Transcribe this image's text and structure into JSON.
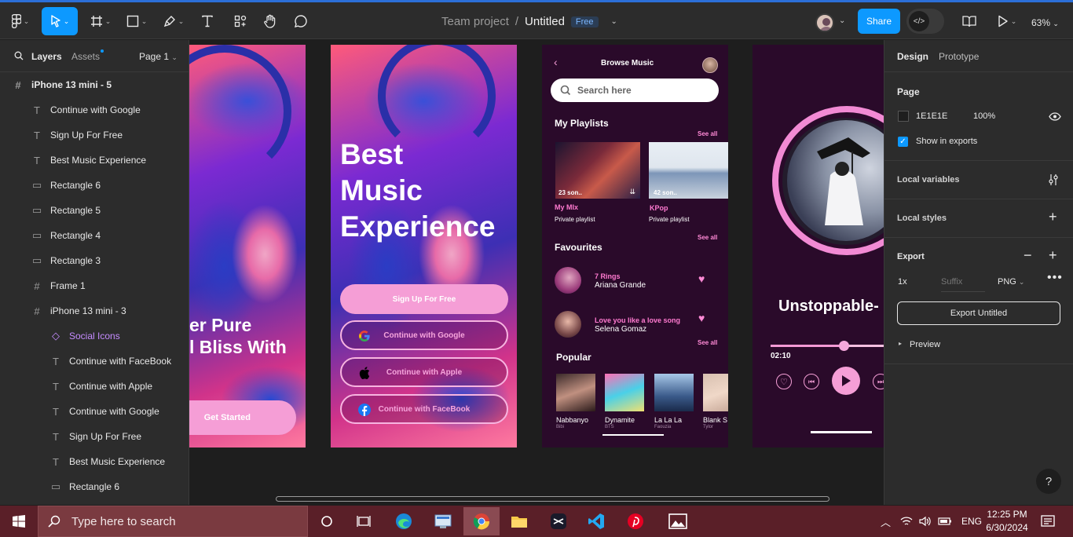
{
  "toolbar": {
    "project": "Team project",
    "separator": "/",
    "file": "Untitled",
    "plan_badge": "Free",
    "share": "Share",
    "zoom": "63%"
  },
  "left_panel": {
    "tabs": {
      "layers": "Layers",
      "assets": "Assets",
      "page": "Page 1"
    },
    "layers": [
      {
        "label": "iPhone 13 mini - 5",
        "icon": "frame-icon"
      },
      {
        "label": "Continue with Google",
        "icon": "text-icon"
      },
      {
        "label": "Sign Up For Free",
        "icon": "text-icon"
      },
      {
        "label": "Best Music Experience",
        "icon": "text-icon"
      },
      {
        "label": "Rectangle 6",
        "icon": "rectangle-icon"
      },
      {
        "label": "Rectangle 5",
        "icon": "rectangle-icon"
      },
      {
        "label": "Rectangle 4",
        "icon": "rectangle-icon"
      },
      {
        "label": "Rectangle 3",
        "icon": "rectangle-icon"
      },
      {
        "label": "Frame 1",
        "icon": "frame-icon"
      },
      {
        "label": "iPhone 13 mini - 3",
        "icon": "frame-icon"
      },
      {
        "label": "Social Icons",
        "icon": "component-icon"
      },
      {
        "label": "Continue with FaceBook",
        "icon": "text-icon"
      },
      {
        "label": "Continue with Apple",
        "icon": "text-icon"
      },
      {
        "label": "Continue with Google",
        "icon": "text-icon"
      },
      {
        "label": "Sign Up For Free",
        "icon": "text-icon"
      },
      {
        "label": "Best Music Experience",
        "icon": "text-icon"
      },
      {
        "label": "Rectangle 6",
        "icon": "rectangle-icon"
      }
    ]
  },
  "canvas": {
    "frame1": {
      "line1": "er Pure",
      "line2": "l Bliss With",
      "cta": "Get Started"
    },
    "frame2": {
      "title_1": "Best",
      "title_2": "Music",
      "title_3": "Experience",
      "signup": "Sign Up For Free",
      "google": "Continue with Google",
      "apple": "Continue with Apple",
      "facebook": "Continue with FaceBook"
    },
    "browse": {
      "header": "Browse Music",
      "search_placeholder": "Search here",
      "my_playlists": "My Playlists",
      "see_all": "See all",
      "playlists": [
        {
          "name": "My MIx",
          "sub": "Private playlist",
          "count": "23 son.."
        },
        {
          "name": "KPop",
          "sub": "Private playlist",
          "count": "42 son.."
        }
      ],
      "favourites": "Favourites",
      "favs": [
        {
          "title": "7 Rings",
          "artist": "Ariana Grande"
        },
        {
          "title": "Love you like a love song",
          "artist": "Selena Gomaz"
        }
      ],
      "popular": "Popular",
      "popular_items": [
        {
          "title": "Nabbanyo",
          "artist": "Bibi"
        },
        {
          "title": "Dynamite",
          "artist": "BTS"
        },
        {
          "title": "La La La",
          "artist": "Faouzia"
        },
        {
          "title": "Blank S",
          "artist": "Tylor"
        }
      ]
    },
    "player": {
      "song": "Unstoppable-",
      "time": "02:10",
      "progress": 0.62
    }
  },
  "right_panel": {
    "tabs": {
      "design": "Design",
      "prototype": "Prototype"
    },
    "page_title": "Page",
    "page_color": "1E1E1E",
    "page_opacity": "100%",
    "show_in_exports": "Show in exports",
    "local_variables": "Local variables",
    "local_styles": "Local styles",
    "export_title": "Export",
    "export_scale": "1x",
    "export_suffix_placeholder": "Suffix",
    "export_format": "PNG",
    "export_button": "Export Untitled",
    "preview": "Preview",
    "help": "?"
  },
  "taskbar": {
    "search_placeholder": "Type here to search",
    "lang": "ENG",
    "time": "12:25 PM",
    "date": "6/30/2024"
  },
  "colors": {
    "accent": "#0d99ff",
    "pink": "#f59ed6",
    "panel": "#2c2c2c",
    "canvas": "#1e1e1e"
  }
}
